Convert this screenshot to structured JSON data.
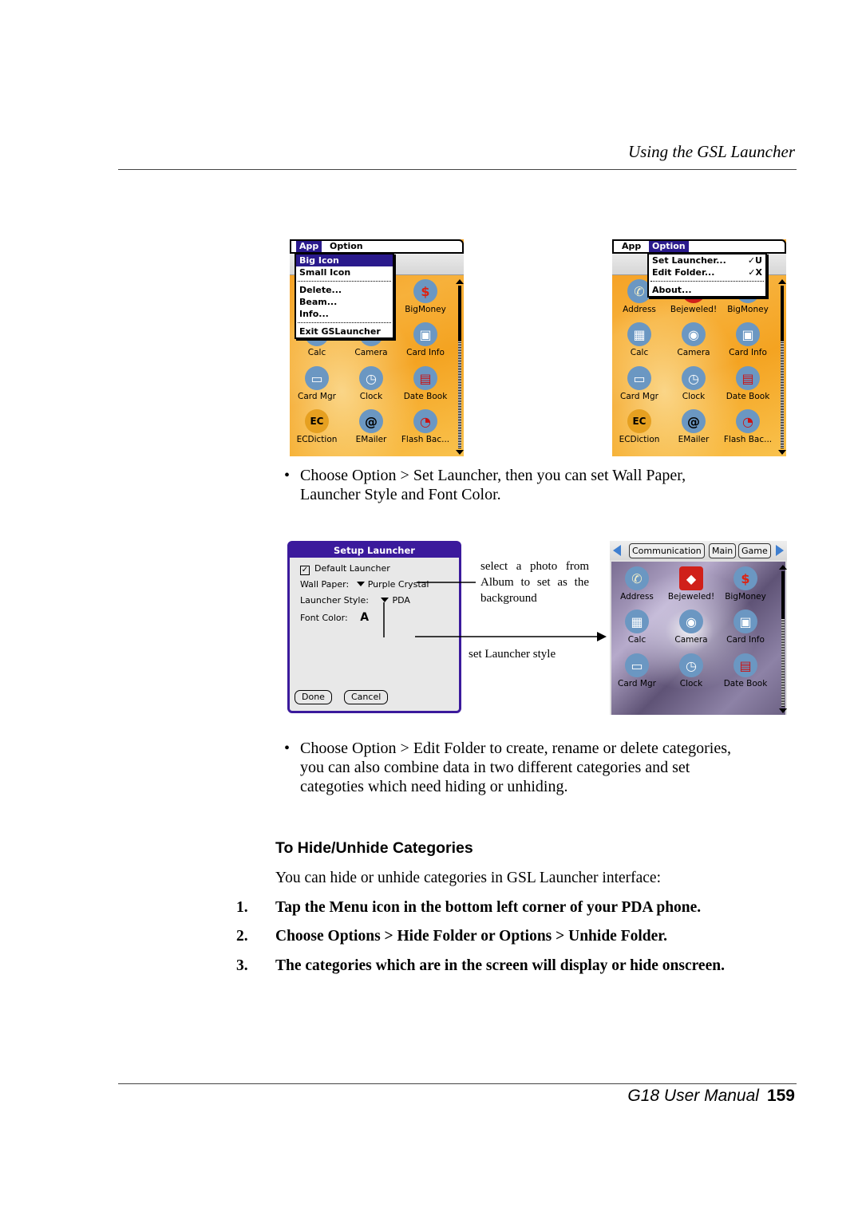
{
  "header": {
    "running_title": "Using the GSL Launcher"
  },
  "footer": {
    "manual": "G18 User Manual",
    "page": "159"
  },
  "screen_app_menu": {
    "menubar": [
      "App",
      "Option"
    ],
    "active_menu": "App",
    "items": [
      "Big Icon",
      "Small Icon",
      "Delete...",
      "Beam...",
      "Info...",
      "Exit GSLauncher"
    ],
    "selected": "Big Icon",
    "apps": [
      {
        "label": "BigMoney",
        "icon": "dollar-icon"
      },
      {
        "label": "Calc",
        "icon": "calculator-icon"
      },
      {
        "label": "Camera",
        "icon": "camera-icon"
      },
      {
        "label": "Card Info",
        "icon": "card-info-icon"
      },
      {
        "label": "Card Mgr",
        "icon": "card-manager-icon"
      },
      {
        "label": "Clock",
        "icon": "alarm-clock-icon"
      },
      {
        "label": "Date Book",
        "icon": "calendar-icon"
      },
      {
        "label": "ECDiction",
        "icon": "dictionary-icon"
      },
      {
        "label": "EMailer",
        "icon": "email-icon"
      },
      {
        "label": "Flash Bac...",
        "icon": "flash-backup-icon"
      }
    ]
  },
  "screen_option_menu": {
    "menubar": [
      "App",
      "Option"
    ],
    "active_menu": "Option",
    "items": [
      {
        "label": "Set Launcher...",
        "shortcut": "✓U"
      },
      {
        "label": "Edit Folder...",
        "shortcut": "✓X"
      },
      {
        "label": "About...",
        "shortcut": ""
      }
    ],
    "apps": [
      {
        "label": "Address",
        "icon": "phone-icon"
      },
      {
        "label": "Bejeweled!",
        "icon": "gem-icon"
      },
      {
        "label": "BigMoney",
        "icon": "dollar-icon"
      },
      {
        "label": "Calc",
        "icon": "calculator-icon"
      },
      {
        "label": "Camera",
        "icon": "camera-icon"
      },
      {
        "label": "Card Info",
        "icon": "card-info-icon"
      },
      {
        "label": "Card Mgr",
        "icon": "card-manager-icon"
      },
      {
        "label": "Clock",
        "icon": "alarm-clock-icon"
      },
      {
        "label": "Date Book",
        "icon": "calendar-icon"
      },
      {
        "label": "ECDiction",
        "icon": "dictionary-icon"
      },
      {
        "label": "EMailer",
        "icon": "email-icon"
      },
      {
        "label": "Flash Bac...",
        "icon": "flash-backup-icon"
      }
    ]
  },
  "bullet1": {
    "line1": "Choose Option > Set Launcher, then you can set Wall Paper,",
    "line2": "Launcher Style and Font Color."
  },
  "setup_dialog": {
    "title": "Setup Launcher",
    "default_launcher_label": "Default Launcher",
    "default_launcher_checked": true,
    "wallpaper_label": "Wall Paper:",
    "wallpaper_value": "Purple Crystal",
    "style_label": "Launcher Style:",
    "style_value": "PDA",
    "font_color_label": "Font Color:",
    "font_color_value": "A",
    "done": "Done",
    "cancel": "Cancel"
  },
  "callouts": {
    "wallpaper_line1": "select a photo from",
    "wallpaper_line2": "Album to set as the",
    "wallpaper_line3": "background",
    "style": "set Launcher style"
  },
  "screen_purple": {
    "tabs": [
      "Communication",
      "Main",
      "Game"
    ],
    "apps": [
      {
        "label": "Address",
        "icon": "phone-icon"
      },
      {
        "label": "Bejeweled!",
        "icon": "gem-icon"
      },
      {
        "label": "BigMoney",
        "icon": "dollar-icon"
      },
      {
        "label": "Calc",
        "icon": "calculator-icon"
      },
      {
        "label": "Camera",
        "icon": "camera-icon"
      },
      {
        "label": "Card Info",
        "icon": "card-info-icon"
      },
      {
        "label": "Card Mgr",
        "icon": "card-manager-icon"
      },
      {
        "label": "Clock",
        "icon": "alarm-clock-icon"
      },
      {
        "label": "Date Book",
        "icon": "calendar-icon"
      }
    ]
  },
  "bullet2": {
    "line1": "Choose Option > Edit Folder to create, rename or delete categories,",
    "line2": "you can also combine data in two different categories and  set",
    "line3": "categoties which need hiding or unhiding."
  },
  "section": {
    "heading": "To Hide/Unhide Categories",
    "intro": "You can hide or unhide categories in GSL Launcher interface:",
    "steps": [
      {
        "n": "1.",
        "text": "Tap the Menu icon in the bottom left corner of your PDA phone."
      },
      {
        "n": "2.",
        "text": "Choose Options > Hide Folder or Options > Unhide Folder."
      },
      {
        "n": "3.",
        "text": "The categories which are in the screen will display or hide onscreen."
      }
    ]
  },
  "colors": {
    "menu_highlight": "#2a1a8c",
    "dialog_frame": "#3b1a9c",
    "wallpaper_orange": "#f5a623",
    "wallpaper_purple": "#7a6d92"
  }
}
